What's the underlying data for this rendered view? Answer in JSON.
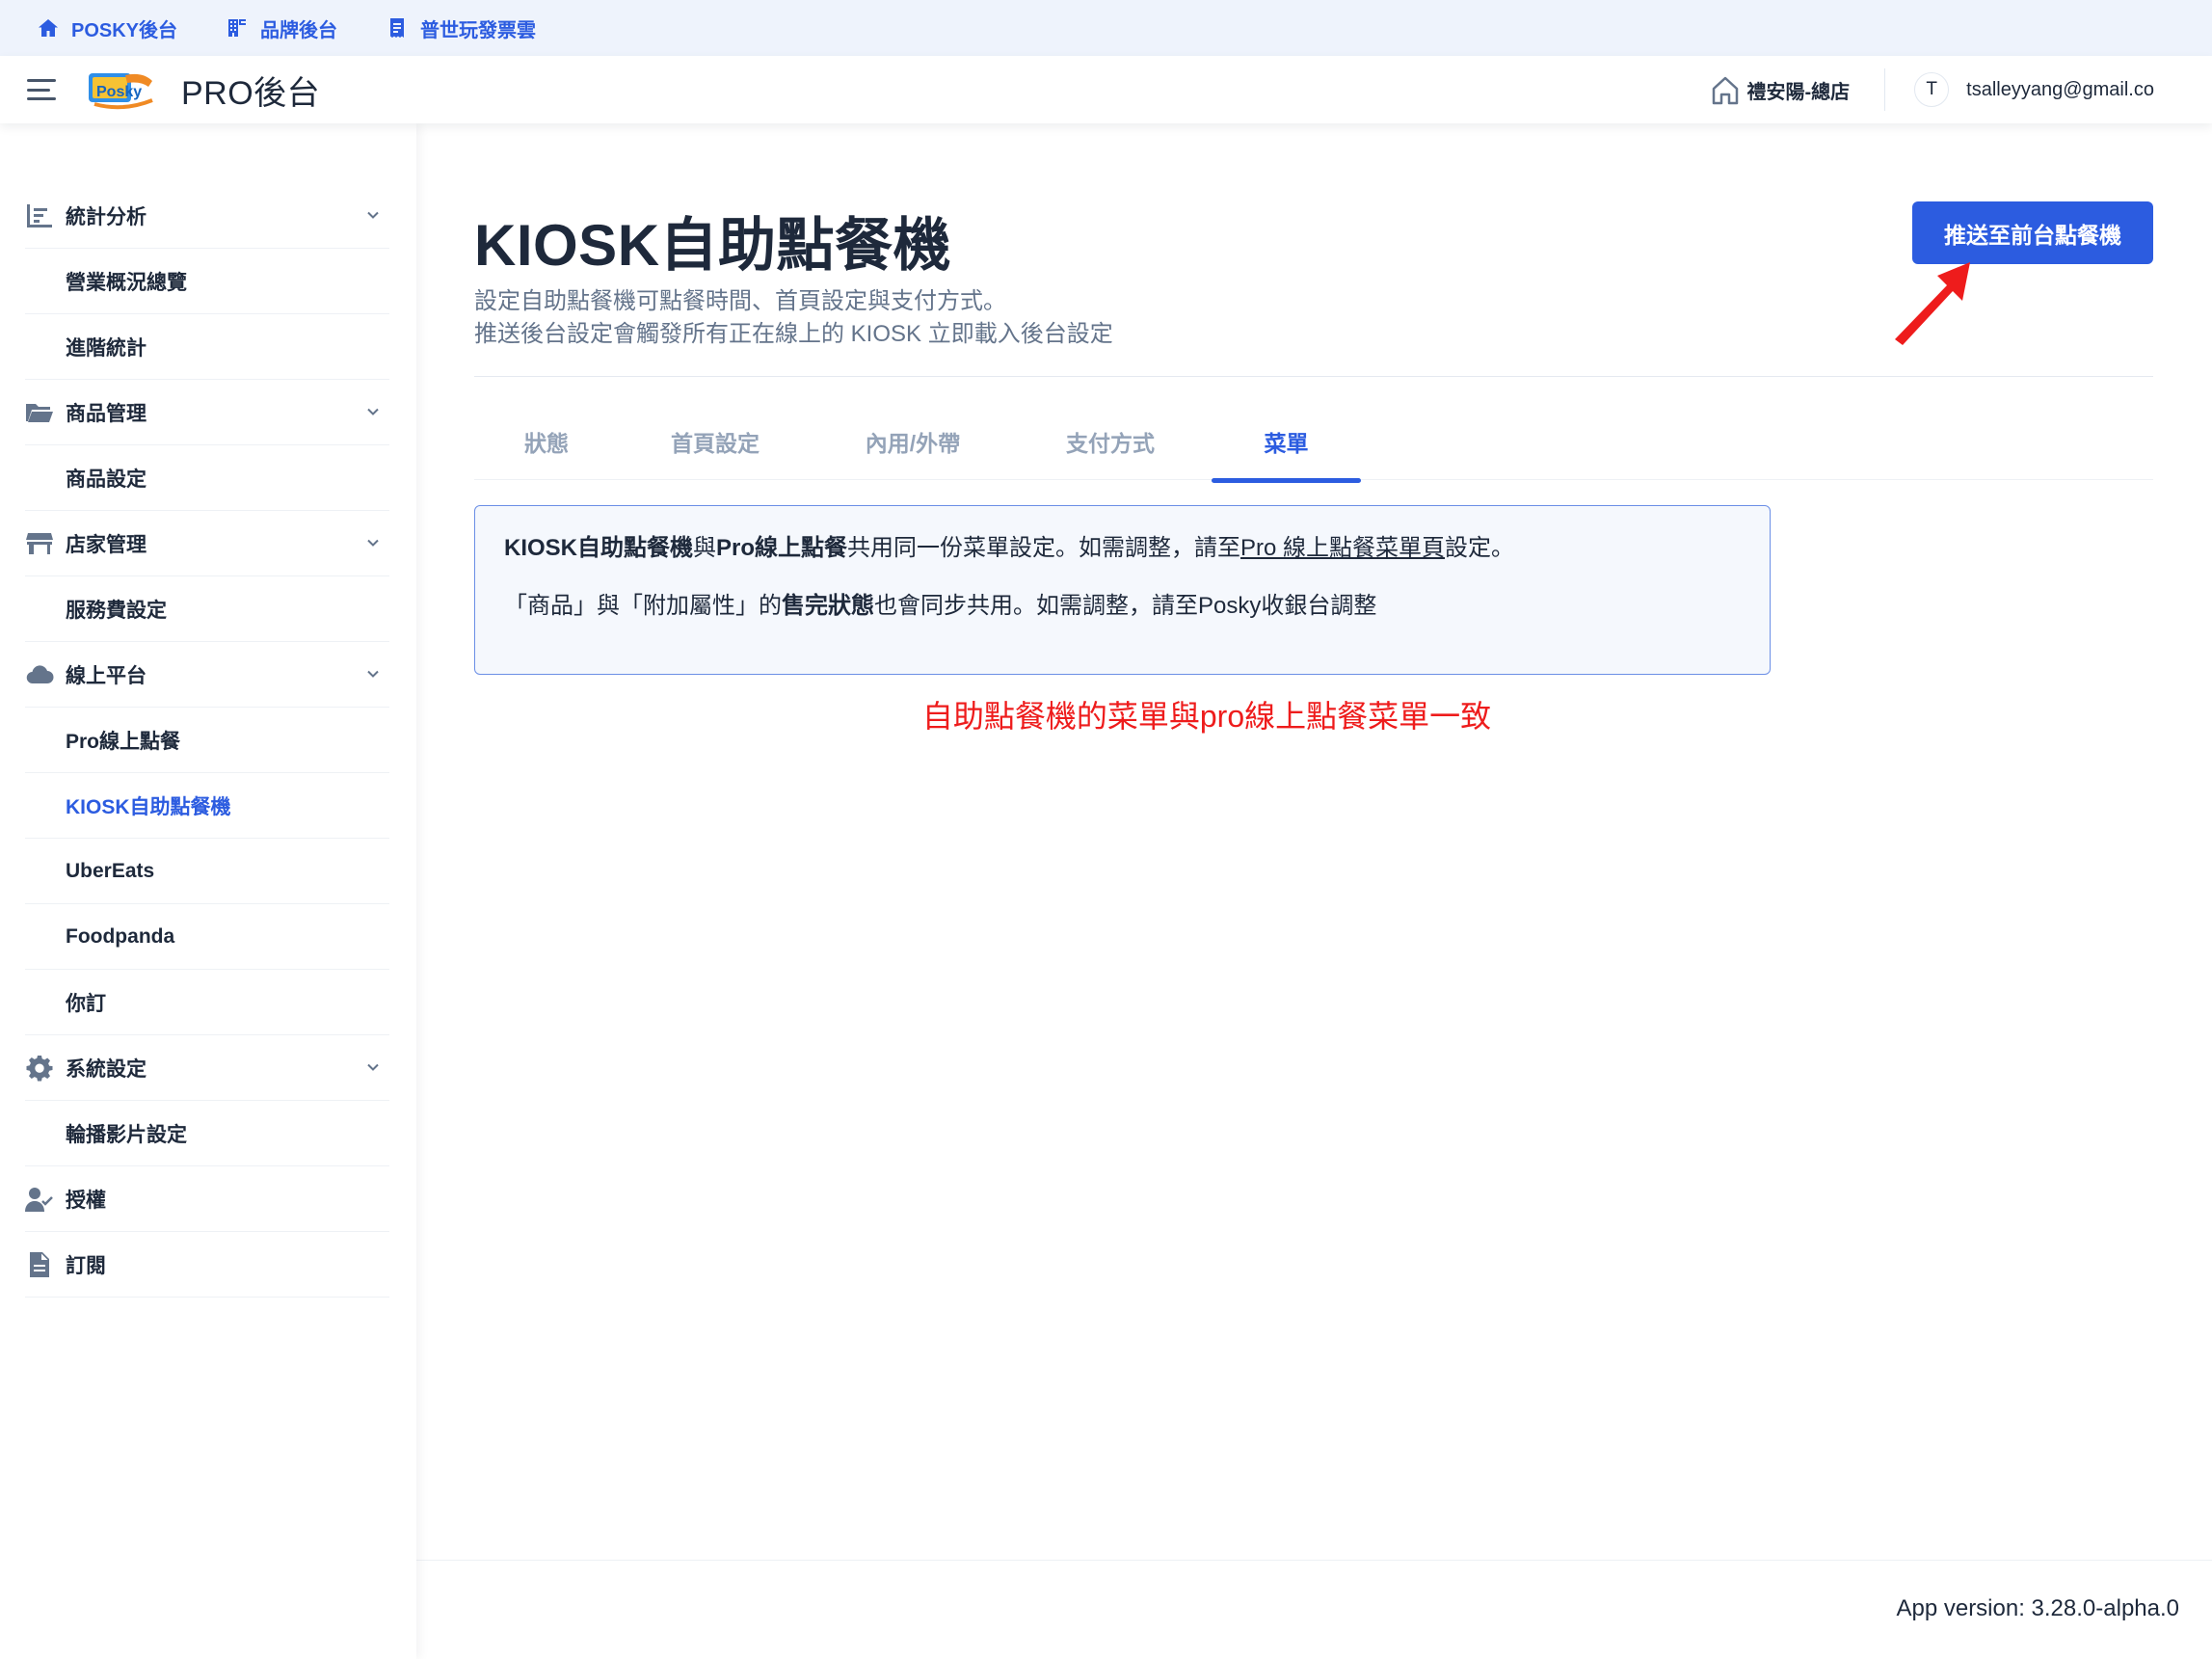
{
  "topbar": {
    "links": [
      {
        "label": "POSKY後台",
        "icon": "home-icon"
      },
      {
        "label": "品牌後台",
        "icon": "building-icon"
      },
      {
        "label": "普世玩發票雲",
        "icon": "receipt-icon"
      }
    ]
  },
  "header": {
    "title": "PRO後台",
    "logo_text": "Posky",
    "store": "禮安陽-總店",
    "avatar_initial": "T",
    "user_email": "tsalleyyang@gmail.co"
  },
  "sidebar": {
    "items": [
      {
        "label": "統計分析",
        "icon": "chart-icon",
        "type": "group"
      },
      {
        "label": "營業概況總覽",
        "type": "child"
      },
      {
        "label": "進階統計",
        "type": "child"
      },
      {
        "label": "商品管理",
        "icon": "folder-icon",
        "type": "group"
      },
      {
        "label": "商品設定",
        "type": "child"
      },
      {
        "label": "店家管理",
        "icon": "store-icon",
        "type": "group"
      },
      {
        "label": "服務費設定",
        "type": "child"
      },
      {
        "label": "線上平台",
        "icon": "cloud-icon",
        "type": "group"
      },
      {
        "label": "Pro線上點餐",
        "type": "child"
      },
      {
        "label": "KIOSK自助點餐機",
        "type": "child",
        "active": true
      },
      {
        "label": "UberEats",
        "type": "child"
      },
      {
        "label": "Foodpanda",
        "type": "child"
      },
      {
        "label": "你訂",
        "type": "child"
      },
      {
        "label": "系統設定",
        "icon": "gear-icon",
        "type": "group"
      },
      {
        "label": "輪播影片設定",
        "type": "child"
      },
      {
        "label": "授權",
        "icon": "user-check-icon",
        "type": "single"
      },
      {
        "label": "訂閱",
        "icon": "document-icon",
        "type": "single"
      }
    ]
  },
  "main": {
    "title": "KIOSK自助點餐機",
    "description_lines": [
      "設定自助點餐機可點餐時間、首頁設定與支付方式。",
      "推送後台設定會觸發所有正在線上的 KIOSK 立即載入後台設定"
    ],
    "push_button": "推送至前台點餐機",
    "tabs": [
      "狀態",
      "首頁設定",
      "內用/外帶",
      "支付方式",
      "菜單"
    ],
    "active_tab": "菜單",
    "info": {
      "line1": {
        "b1": "KIOSK自助點餐機",
        "t1": "與",
        "b2": "Pro線上點餐",
        "t2": "共用同一份菜單設定。如需調整，請至",
        "link": "Pro 線上點餐菜單頁",
        "t3": "設定。"
      },
      "line2": {
        "t1": "「商品」與「附加屬性」的",
        "b1": "售完狀態",
        "t2": "也會同步共用。如需調整，請至Posky收銀台調整"
      }
    },
    "annotation": "自助點餐機的菜單與pro線上點餐菜單一致",
    "annotation_color": "#ee1c1c"
  },
  "footer": {
    "version": "App version: 3.28.0-alpha.0"
  },
  "colors": {
    "primary": "#2c5ce0",
    "topstrip_bg": "#eef3fc",
    "text": "#1e293b",
    "muted": "#64748b"
  }
}
